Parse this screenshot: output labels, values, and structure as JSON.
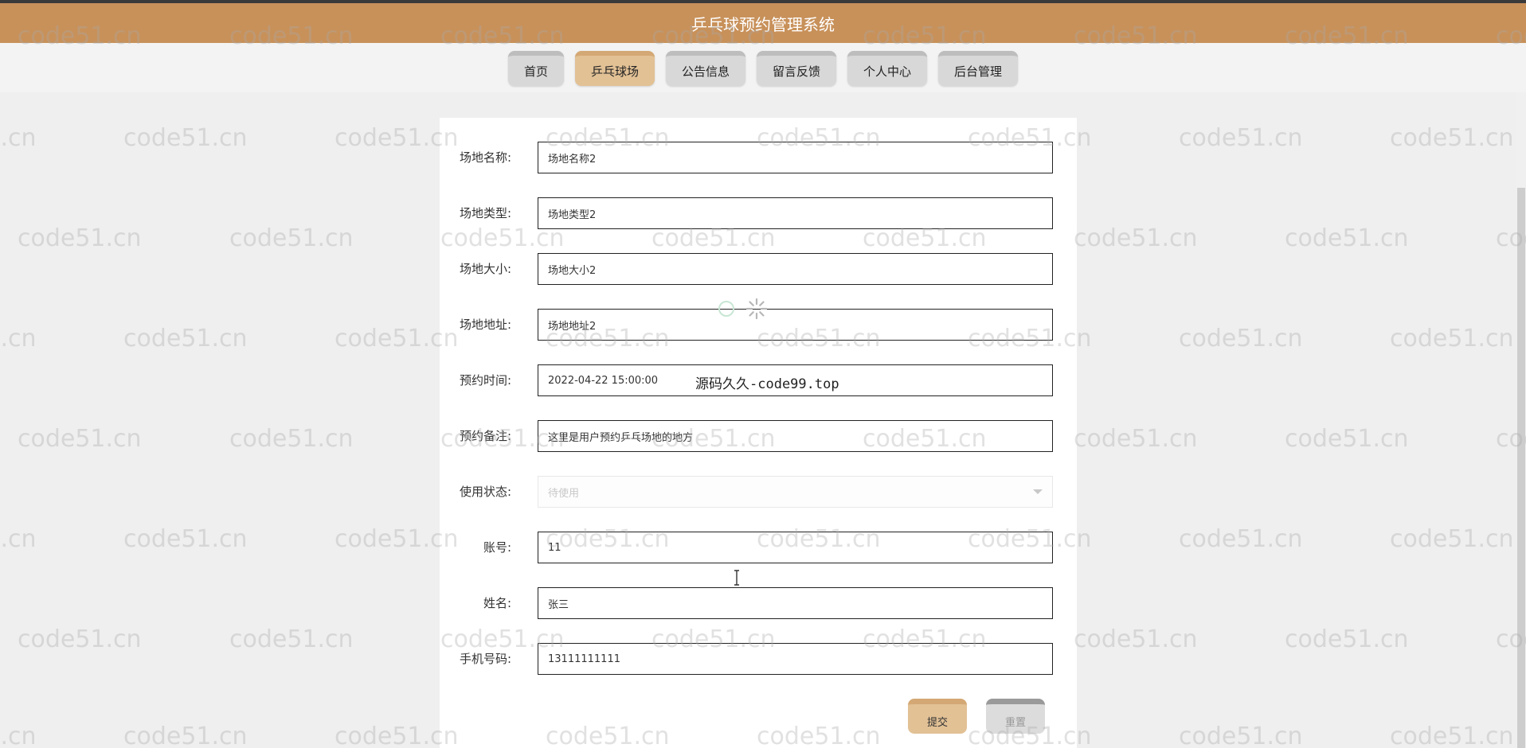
{
  "app": {
    "title": "乒乓球预约管理系统"
  },
  "nav": {
    "tabs": [
      {
        "label": "首页",
        "active": false
      },
      {
        "label": "乒乓球场",
        "active": true
      },
      {
        "label": "公告信息",
        "active": false
      },
      {
        "label": "留言反馈",
        "active": false
      },
      {
        "label": "个人中心",
        "active": false
      },
      {
        "label": "后台管理",
        "active": false
      }
    ]
  },
  "form": {
    "fields": [
      {
        "label": "场地名称:",
        "value": "场地名称2"
      },
      {
        "label": "场地类型:",
        "value": "场地类型2"
      },
      {
        "label": "场地大小:",
        "value": "场地大小2"
      },
      {
        "label": "场地地址:",
        "value": "场地地址2"
      },
      {
        "label": "预约时间:",
        "value": "2022-04-22 15:00:00"
      },
      {
        "label": "预约备注:",
        "value": "这里是用户预约乒乓场地的地方"
      },
      {
        "label": "使用状态:",
        "value": "待使用",
        "disabled": true
      },
      {
        "label": "账号:",
        "value": "11"
      },
      {
        "label": "姓名:",
        "value": "张三"
      },
      {
        "label": "手机号码:",
        "value": "13111111111"
      }
    ],
    "submit_label": "提交",
    "reset_label": "重置"
  },
  "overlay_text": "源码久久-code99.top",
  "watermark": "code51.cn",
  "colors": {
    "header_bg": "#c8915a",
    "active_tab": "#e2c195",
    "inactive_tab": "#d8d8d8"
  }
}
